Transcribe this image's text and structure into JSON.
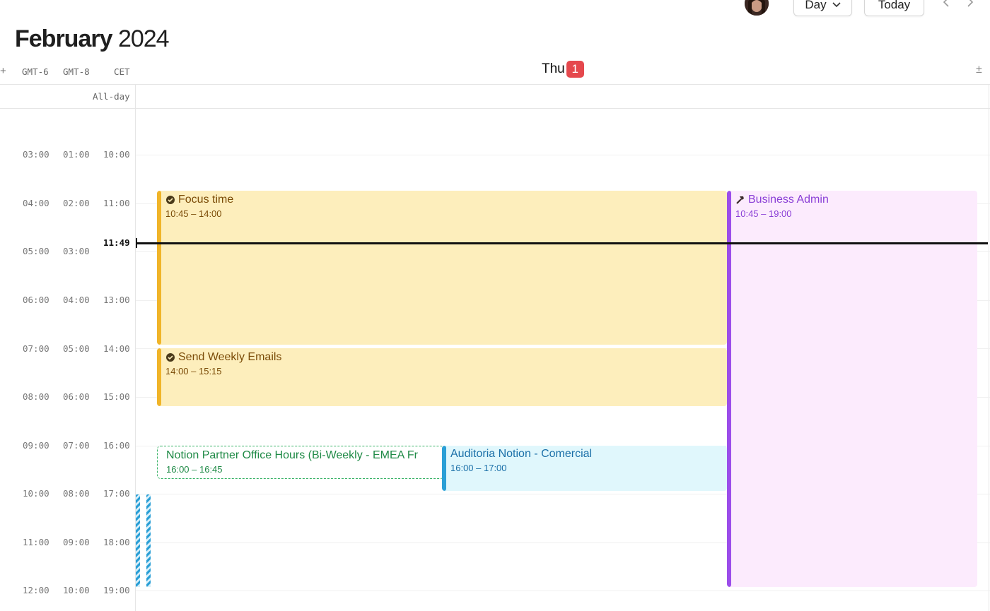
{
  "header": {
    "month": "February",
    "year": "2024",
    "view_label": "Day",
    "today_label": "Today"
  },
  "timezones": {
    "add": "+",
    "zones": [
      "GMT-6",
      "GMT-8",
      "CET"
    ],
    "adjust": "±"
  },
  "day": {
    "name": "Thu",
    "number": "1"
  },
  "allday_label": "All-day",
  "time_rows": [
    {
      "tz1": "03:00",
      "tz2": "01:00",
      "tz3": "10:00"
    },
    {
      "tz1": "04:00",
      "tz2": "02:00",
      "tz3": "11:00"
    },
    {
      "tz1": "05:00",
      "tz2": "03:00",
      "tz3": ""
    },
    {
      "tz1": "06:00",
      "tz2": "04:00",
      "tz3": "13:00"
    },
    {
      "tz1": "07:00",
      "tz2": "05:00",
      "tz3": "14:00"
    },
    {
      "tz1": "08:00",
      "tz2": "06:00",
      "tz3": "15:00"
    },
    {
      "tz1": "09:00",
      "tz2": "07:00",
      "tz3": "16:00"
    },
    {
      "tz1": "10:00",
      "tz2": "08:00",
      "tz3": "17:00"
    },
    {
      "tz1": "11:00",
      "tz2": "09:00",
      "tz3": "18:00"
    },
    {
      "tz1": "12:00",
      "tz2": "10:00",
      "tz3": "19:00"
    }
  ],
  "now": "11:49",
  "events": {
    "focus": {
      "title": "Focus time",
      "time": "10:45 – 14:00",
      "icon": "check-circle-icon"
    },
    "emails": {
      "title": "Send Weekly Emails",
      "time": "14:00 – 15:15",
      "icon": "check-circle-icon"
    },
    "admin": {
      "title": "Business Admin",
      "time": "10:45 – 19:00",
      "icon": "hammer-icon"
    },
    "office_hours": {
      "title": "Notion Partner Office Hours (Bi-Weekly - EMEA Fr",
      "time": "16:00 – 16:45"
    },
    "auditoria": {
      "title": "Auditoria Notion - Comercial",
      "time": "16:00 – 17:00"
    }
  },
  "colors": {
    "today_badge": "#e5484d",
    "focus_bar": "#f0b429",
    "admin_bar": "#9b4dea",
    "auditoria_bar": "#2a9fd6",
    "office_hours_border": "#37b265"
  }
}
